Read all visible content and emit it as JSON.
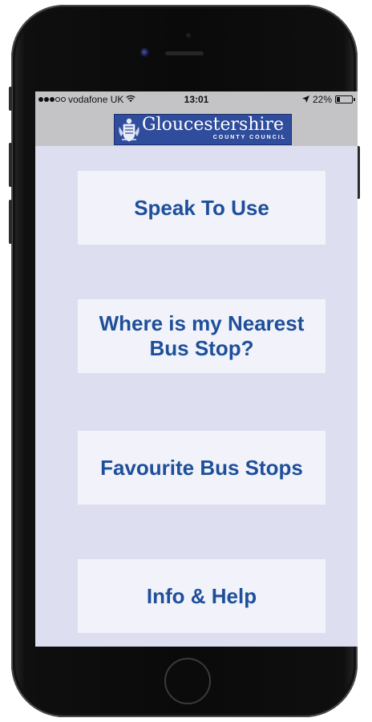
{
  "status_bar": {
    "carrier": "vodafone UK",
    "signal_bars_filled": 3,
    "signal_bars_total": 5,
    "wifi_icon": "wifi-icon",
    "time": "13:01",
    "location_icon": "location-arrow-icon",
    "battery_percent": "22%",
    "battery_level": 0.22
  },
  "header": {
    "logo_name": "Gloucestershire",
    "logo_subtitle": "COUNTY COUNCIL",
    "logo_color": "#2f4d9c"
  },
  "menu": {
    "speak_to_use": "Speak To Use",
    "nearest_stop": "Where is my Nearest Bus Stop?",
    "favourite_stops": "Favourite Bus Stops",
    "info_help": "Info & Help"
  },
  "colors": {
    "screen_background": "#dddff0",
    "button_background": "#f1f2fa",
    "button_text": "#1e4f9a",
    "status_bar_background": "#c4c4c7"
  }
}
